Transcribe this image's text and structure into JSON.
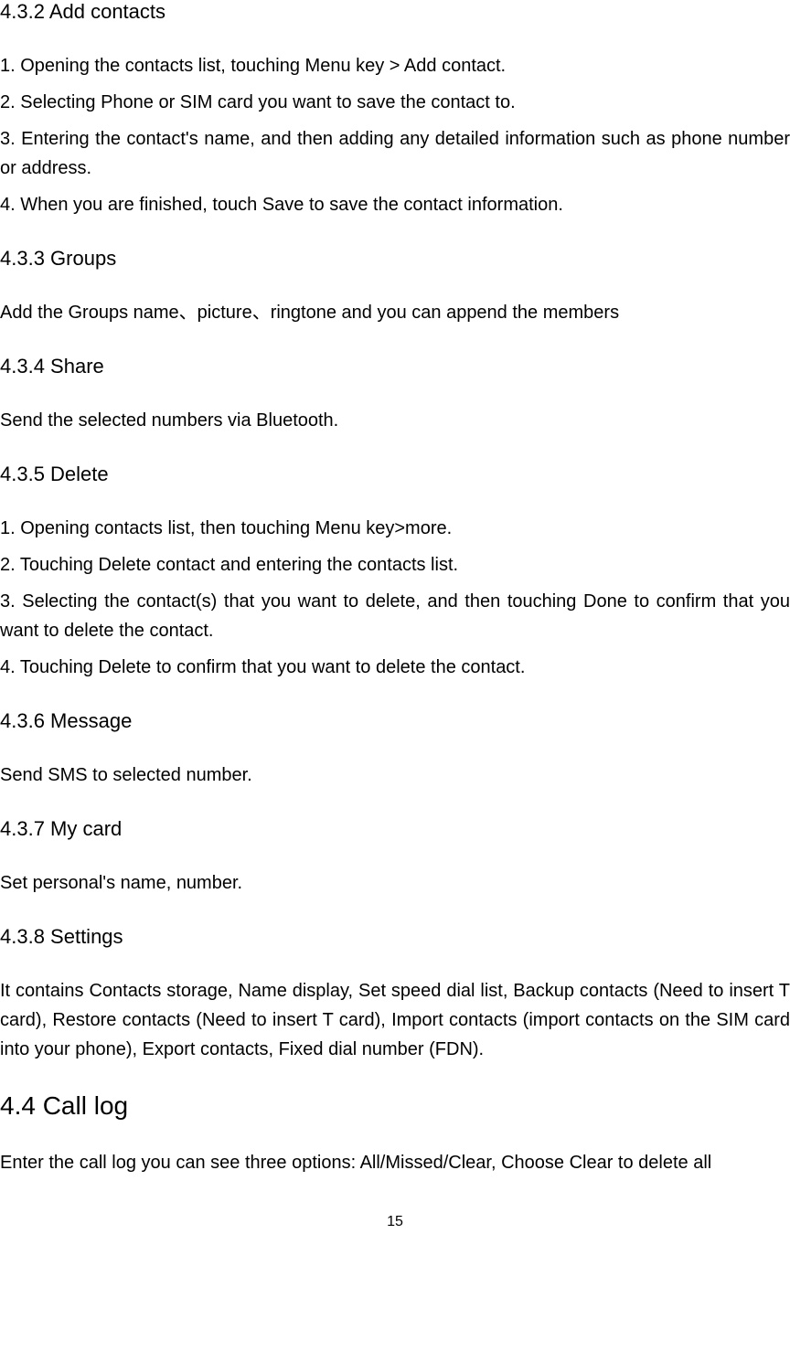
{
  "sections": {
    "s432": {
      "heading": "4.3.2 Add contacts",
      "lines": [
        "1. Opening the contacts list, touching Menu key > Add contact.",
        "2. Selecting Phone or SIM card you want to save the contact to.",
        "3. Entering the contact's name, and then adding any detailed information such as phone number or address.",
        "4. When you are finished, touch Save to save the contact information."
      ]
    },
    "s433": {
      "heading": "4.3.3 Groups",
      "body": "Add the Groups name、picture、ringtone and you can append the members"
    },
    "s434": {
      "heading": "4.3.4 Share",
      "body": "Send the selected numbers via Bluetooth."
    },
    "s435": {
      "heading": "4.3.5 Delete",
      "lines": [
        "1. Opening contacts list, then touching Menu key>more.",
        "2. Touching Delete contact and entering the contacts list.",
        "3. Selecting the contact(s) that you want to delete, and then touching Done to confirm that you want to delete the contact.",
        "4. Touching Delete to confirm that you want to delete the contact."
      ]
    },
    "s436": {
      "heading": "4.3.6 Message",
      "body": "Send SMS to selected number."
    },
    "s437": {
      "heading": "4.3.7 My card",
      "body": "Set personal's name, number."
    },
    "s438": {
      "heading": "4.3.8 Settings",
      "body": "It contains Contacts storage, Name display, Set speed dial list, Backup contacts (Need to insert T card), Restore contacts (Need to insert T card), Import contacts (import contacts on the SIM card into your phone), Export contacts, Fixed dial number (FDN)."
    },
    "s44": {
      "heading": "4.4 Call log",
      "body": "Enter the call log you can see three options: All/Missed/Clear, Choose Clear to delete all"
    }
  },
  "pageNumber": "15"
}
